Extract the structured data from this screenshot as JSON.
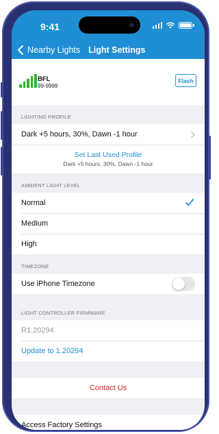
{
  "status": {
    "time": "9:41"
  },
  "nav": {
    "back_label": "Nearby Lights",
    "title": "Light Settings"
  },
  "device": {
    "name": "BFL",
    "id": "99-9999",
    "flash_label": "Flash",
    "signal_color": "#2fb52a"
  },
  "lighting_profile": {
    "header": "LIGHTING PROFILE",
    "current": "Dark +5 hours, 30%, Dawn -1 hour",
    "set_last_label": "Set Last Used Profile",
    "set_last_sub": "Dark +5 hours, 30%, Dawn -1 hour"
  },
  "ambient": {
    "header": "AMBIENT LIGHT LEVEL",
    "options": [
      "Normal",
      "Medium",
      "High"
    ],
    "selected": "Normal"
  },
  "timezone": {
    "header": "TIMEZONE",
    "label": "Use iPhone Timezone",
    "enabled": false
  },
  "firmware": {
    "header": "LIGHT CONTROLLER FIRMWARE",
    "current": "R1.20294",
    "update_label": "Update to 1.20294"
  },
  "contact": {
    "label": "Contact Us"
  },
  "factory": {
    "label": "Access Factory Settings"
  },
  "colors": {
    "accent": "#1f8ed4",
    "destructive": "#d0202a",
    "background": "#efeff4"
  }
}
